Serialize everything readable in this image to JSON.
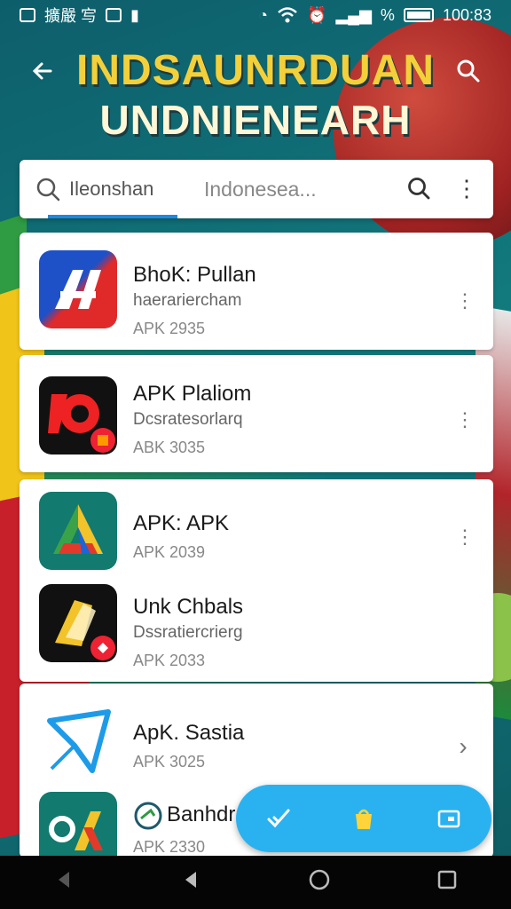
{
  "statusbar": {
    "left_text": "擴嚴 㝍",
    "percent_text": "%",
    "time": "100:83"
  },
  "header": {
    "title_line1": "INDSAUNRDUAN",
    "title_line2": "UNDNIENEARH"
  },
  "search": {
    "tab_active_label": "Ileonshan",
    "tab_inactive_label": "Indonesea..."
  },
  "apps": [
    {
      "title": "BhoK: Pullan",
      "subtitle": "haerariercham",
      "version": "APK 2935"
    },
    {
      "title": "APK Plaliom",
      "subtitle": "Dcsratesorlarq",
      "version": "ABK 3035"
    },
    {
      "title": "APK: APK",
      "subtitle": "",
      "version": "APK 2039"
    },
    {
      "title": "Unk Chbals",
      "subtitle": "Dssratiercrierg",
      "version": "APK 2033"
    },
    {
      "title": "ApK. Sastia",
      "subtitle": "",
      "version": "APK 3025"
    },
    {
      "title": "Banhdra",
      "subtitle": "",
      "version": "APK 2330"
    }
  ],
  "icons": {
    "back": "arrow-left-icon",
    "search": "search-icon",
    "more": "more-vertical-icon",
    "chevron": "chevron-right-icon",
    "fab": [
      "check-icon",
      "shopping-bag-icon",
      "card-icon"
    ],
    "nav": [
      "nav-back-icon",
      "home-icon",
      "recents-icon"
    ]
  },
  "colors": {
    "accent": "#1e88e5",
    "fab": "#2ab2f0",
    "title_yellow": "#f3d03a"
  }
}
